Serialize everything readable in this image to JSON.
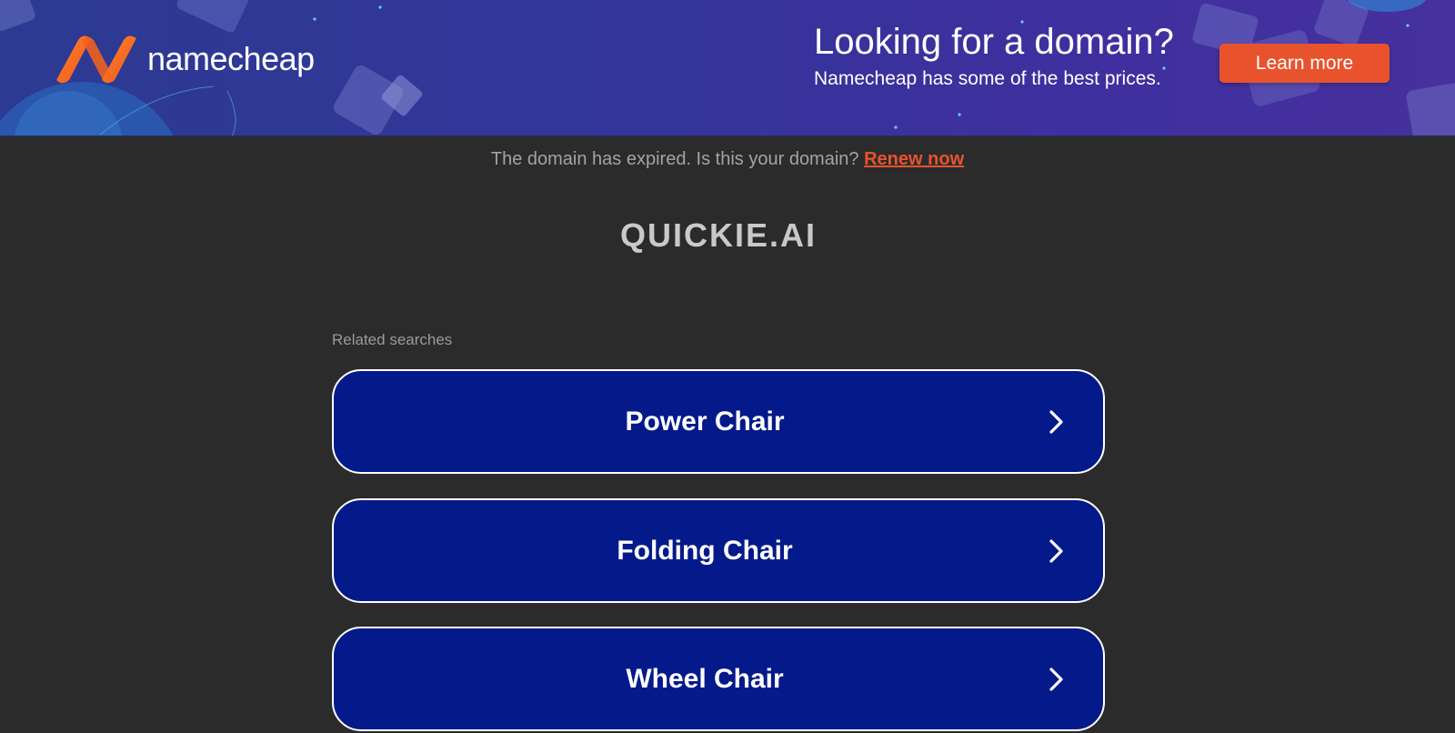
{
  "banner": {
    "logo_text": "namecheap",
    "headline": "Looking for a domain?",
    "subline": "Namecheap has some of the best prices.",
    "cta_label": "Learn more",
    "colors": {
      "accent": "#e8532d",
      "banner_bg": "#34359a"
    }
  },
  "notice": {
    "text": "The domain has expired. Is this your domain?",
    "link_label": "Renew now"
  },
  "domain": {
    "name": "QUICKIE.AI"
  },
  "related": {
    "label": "Related searches",
    "items": [
      {
        "label": "Power Chair",
        "icon": "chevron-right-icon"
      },
      {
        "label": "Folding Chair",
        "icon": "chevron-right-icon"
      },
      {
        "label": "Wheel Chair",
        "icon": "chevron-right-icon"
      }
    ],
    "colors": {
      "button_bg": "#041a8a",
      "button_border": "#ffffff"
    }
  }
}
